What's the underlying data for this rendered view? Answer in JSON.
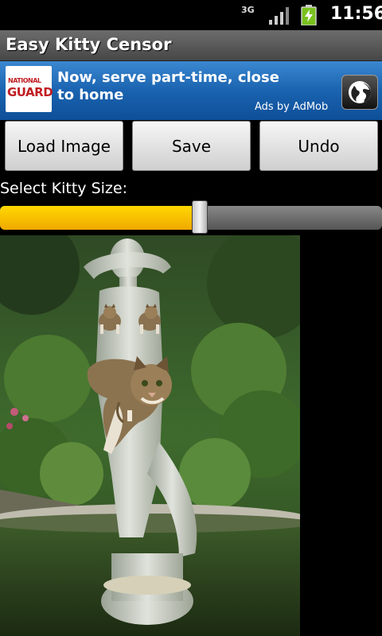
{
  "status_bar": {
    "network": "3G",
    "time": "11:56",
    "icons": [
      "signal-icon",
      "battery-charging-icon"
    ]
  },
  "app": {
    "title": "Easy Kitty Censor"
  },
  "ad": {
    "logo_line1": "NATIONAL",
    "logo_line2": "GUARD",
    "headline": "Now, serve part-time, close to home",
    "attribution": "Ads by AdMob",
    "icon": "globe-icon"
  },
  "toolbar": {
    "load_label": "Load Image",
    "save_label": "Save",
    "undo_label": "Undo"
  },
  "kitty_size": {
    "label": "Select Kitty Size:",
    "value_fraction": 0.52
  },
  "colors": {
    "accent": "#f4b400",
    "ad_blue": "#1a63b0"
  }
}
